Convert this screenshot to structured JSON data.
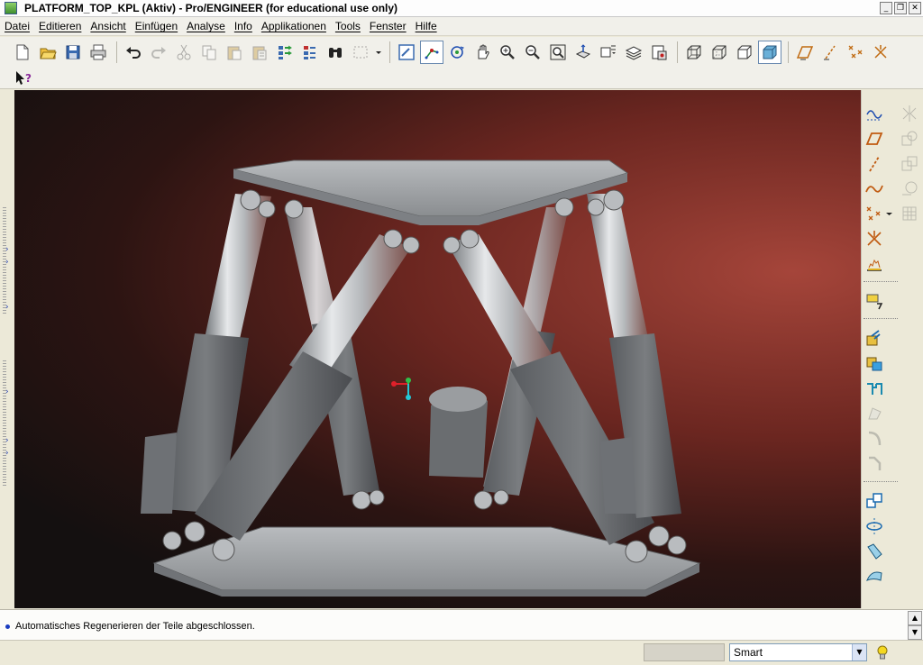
{
  "window": {
    "title": "PLATFORM_TOP_KPL (Aktiv) - Pro/ENGINEER (for educational use only)"
  },
  "menu": [
    "Datei",
    "Editieren",
    "Ansicht",
    "Einfügen",
    "Analyse",
    "Info",
    "Applikationen",
    "Tools",
    "Fenster",
    "Hilfe"
  ],
  "message": {
    "text": "Automatisches Regenerieren der Teile abgeschlossen."
  },
  "status": {
    "filter_value": "Smart"
  },
  "colors": {
    "viewport_accent": "#a5453a",
    "model_gray": "#a9acb0",
    "datum_x": "#e0202a",
    "datum_y": "#2fc24a",
    "datum_z": "#22c8d8"
  },
  "icons": {
    "toolbar": [
      "new-file-icon",
      "open-folder-icon",
      "save-icon",
      "print-icon",
      "undo-icon",
      "redo-icon",
      "cut-icon",
      "copy-icon",
      "paste-icon",
      "paste-special-icon",
      "regenerate-icon",
      "regen-manager-icon",
      "find-icon",
      "select-box-icon",
      "repaint-icon",
      "spin-center-icon",
      "orient-mode-icon",
      "pan-hand-icon",
      "zoom-in-icon",
      "zoom-out-icon",
      "refit-icon",
      "reorient-icon",
      "saved-views-icon",
      "layers-icon",
      "view-manager-icon",
      "wireframe-icon",
      "hidden-line-icon",
      "no-hidden-icon",
      "shading-icon",
      "datum-planes-icon",
      "datum-axes-icon",
      "datum-points-icon",
      "coord-sys-icon"
    ],
    "right": [
      "sketch-tool-icon",
      "plane-tool-icon",
      "axis-tool-icon",
      "curve-tool-icon",
      "point-tool-icon",
      "csys-tool-icon",
      "analysis-tool-icon",
      "annotation-icon",
      "extrude-icon",
      "revolve-icon",
      "sweep-icon",
      "blend-icon",
      "round-icon",
      "chamfer-icon",
      "pattern-icon",
      "mirror-icon",
      "draft-icon",
      "style-icon"
    ]
  }
}
